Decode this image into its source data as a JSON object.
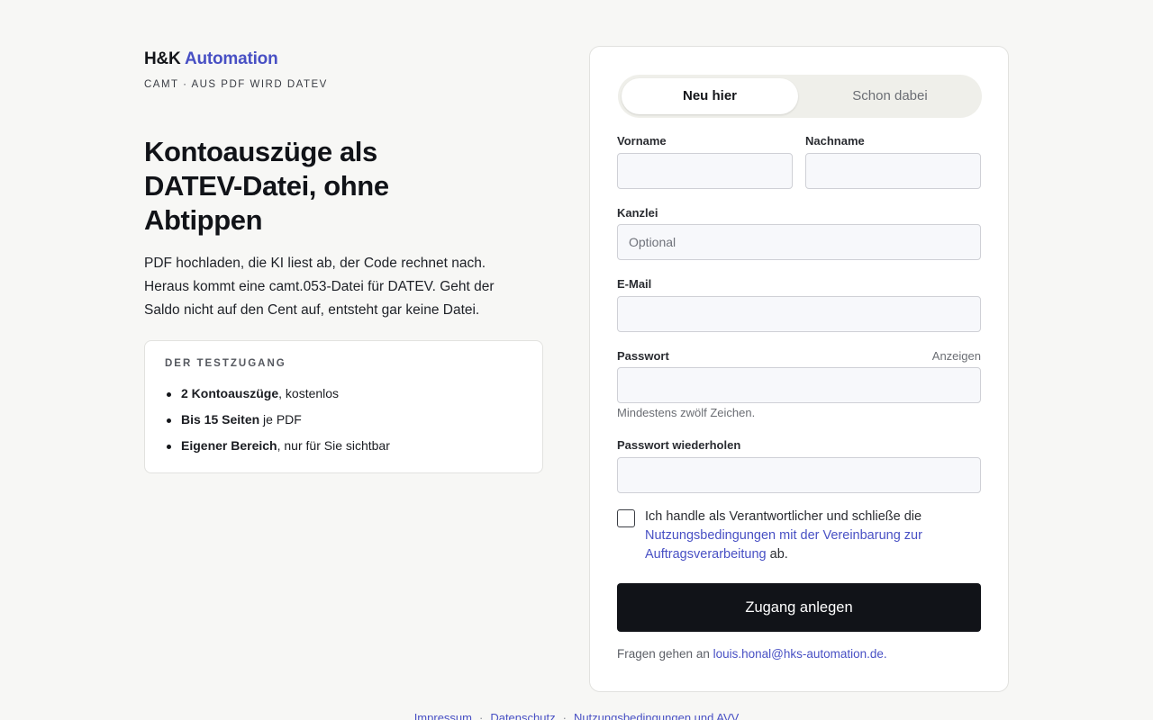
{
  "brand": {
    "name": "H&K",
    "accent": "Automation",
    "accent_color": "#4850c4"
  },
  "tagline": "CAMT · AUS PDF WIRD DATEV",
  "headline": "Kontoauszüge als DATEV-Datei, ohne Abtippen",
  "lead": "PDF hochladen, die KI liest ab, der Code rechnet nach. Heraus kommt eine camt.053-Datei für DATEV. Geht der Saldo nicht auf den Cent auf, entsteht gar keine Datei.",
  "testbox": {
    "title": "DER TESTZUGANG",
    "items": [
      {
        "bold": "2 Kontoauszüge",
        "rest": ", kostenlos"
      },
      {
        "bold": "Bis 15 Seiten",
        "rest": " je PDF"
      },
      {
        "bold": "Eigener Bereich",
        "rest": ", nur für Sie sichtbar"
      }
    ]
  },
  "tabs": {
    "signup": "Neu hier",
    "login": "Schon dabei"
  },
  "form": {
    "firstname_label": "Vorname",
    "lastname_label": "Nachname",
    "firm_label": "Kanzlei",
    "firm_placeholder": "Optional",
    "email_label": "E-Mail",
    "password_label": "Passwort",
    "password_show": "Anzeigen",
    "password_hint": "Mindestens zwölf Zeichen.",
    "password_repeat_label": "Passwort wiederholen",
    "consent_before": "Ich handle als Verantwortlicher und schließe die ",
    "consent_link": "Nutzungsbedingungen mit der Vereinbarung zur Auftragsverarbeitung",
    "consent_after": " ab.",
    "consent_checked": false,
    "submit_label": "Zugang anlegen",
    "contact_prefix": "Fragen gehen an ",
    "contact_email": "louis.honal@hks-automation.de."
  },
  "footer": {
    "links": [
      "Impressum",
      "Datenschutz",
      "Nutzungsbedingungen und AVV"
    ]
  },
  "colors": {
    "background": "#f7f7f5",
    "primary_button": "#111318",
    "link": "#4850c4"
  }
}
